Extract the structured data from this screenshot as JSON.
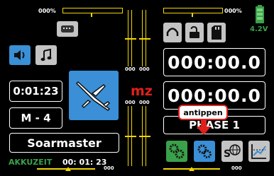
{
  "trims": {
    "top_left": {
      "pct": "000%",
      "level": 0.0
    },
    "top_right": {
      "pct": "000%",
      "level": 0.0
    },
    "left_vertical": {
      "a": "000",
      "b": "000"
    },
    "right_vertical": {
      "a": "000",
      "b": "000"
    },
    "bottom_left_value": "000",
    "bottom_right_value": "000"
  },
  "battery": {
    "voltage": "4.2V",
    "color": "#3aa14a"
  },
  "timers": {
    "stopwatch": "0:01:23",
    "flight_timer": "000:00.0",
    "model_timer": "000:00.0"
  },
  "model": {
    "memory": "M - 4",
    "name": "Soarmaster",
    "modulation": "mz",
    "akku_label": "AKKUZEIT",
    "akku_value": "00: 01: 23"
  },
  "phase": {
    "label": "PHASE 1"
  },
  "callout": {
    "text": "antippen"
  },
  "icons": {
    "keyboard": "keyboard-icon",
    "speaker": "speaker-icon",
    "music": "music-note-icon",
    "headphones": "headphones-icon",
    "lock": "lock-icon",
    "sd": "sd-card-icon",
    "system_settings": "gears-icon",
    "model_settings": "gears-fine-icon",
    "service": "globe-s-icon",
    "telemetry": "graph-icon"
  },
  "colors": {
    "accent_yellow": "#f2d600",
    "blue": "#3a8fd6",
    "red": "#e0201b",
    "green": "#3aa14a"
  }
}
